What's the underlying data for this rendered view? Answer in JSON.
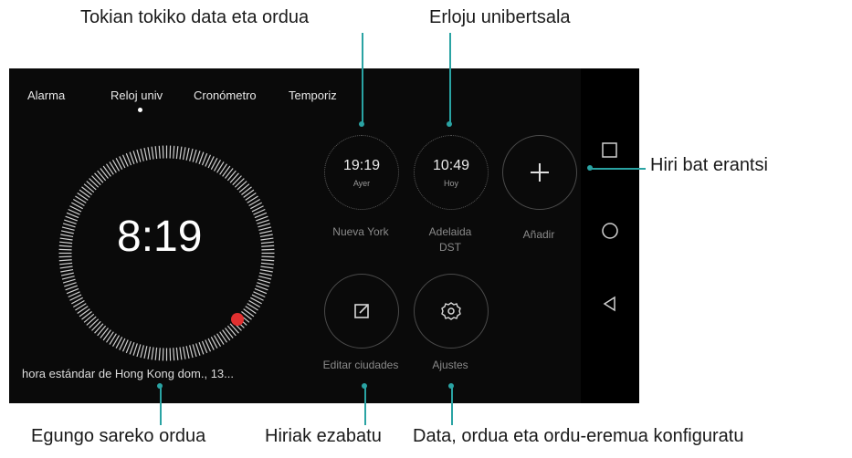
{
  "callouts": {
    "date_time_local": "Tokian tokiko data eta ordua",
    "world_clock": "Erloju unibertsala",
    "add_city": "Hiri bat erantsi",
    "network_time": "Egungo sareko ordua",
    "delete_cities": "Hiriak ezabatu",
    "date_time_settings": "Data, ordua eta ordu-eremua konfiguratu"
  },
  "tabs": [
    {
      "label": "Alarma"
    },
    {
      "label": "Reloj univ"
    },
    {
      "label": "Cronómetro"
    },
    {
      "label": "Temporiz"
    }
  ],
  "active_tab": "Reloj univ",
  "main_clock": {
    "time": "8:19",
    "footer": "hora estándar de Hong Kong  dom., 13..."
  },
  "cities": [
    {
      "time": "19:19",
      "day": "Ayer",
      "name": "Nueva York",
      "extra": ""
    },
    {
      "time": "10:49",
      "day": "Hoy",
      "name": "Adelaida",
      "extra": "DST"
    }
  ],
  "add_button": {
    "label": "Añadir"
  },
  "edit_button": {
    "label": "Editar ciudades"
  },
  "settings_button": {
    "label": "Ajustes"
  },
  "colors": {
    "accent_red": "#e03030",
    "callout_line": "#2aa3a3"
  },
  "icons": {
    "add": "plus-icon",
    "edit": "edit-icon",
    "settings": "gear-icon",
    "nav_recent": "square-icon",
    "nav_home": "circle-icon",
    "nav_back": "triangle-back-icon"
  }
}
